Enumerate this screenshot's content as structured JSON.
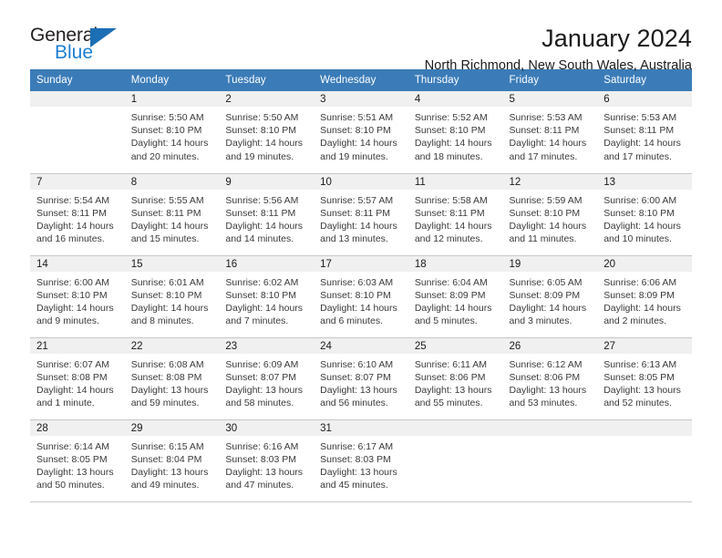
{
  "brand": {
    "name_part1": "General",
    "name_part2": "Blue",
    "accent_color": "#1b7fd4",
    "triangle_color": "#1c6fb5"
  },
  "header": {
    "title": "January 2024",
    "subtitle": "North Richmond, New South Wales, Australia",
    "header_bg_color": "#3b7cb8",
    "daynum_bg_color": "#f0f0f0"
  },
  "calendar": {
    "weekday_headers": [
      "Sunday",
      "Monday",
      "Tuesday",
      "Wednesday",
      "Thursday",
      "Friday",
      "Saturday"
    ],
    "weeks": [
      [
        {
          "day": "",
          "sunrise": "",
          "sunset": "",
          "daylight_line1": "",
          "daylight_line2": "",
          "empty": true
        },
        {
          "day": "1",
          "sunrise": "Sunrise: 5:50 AM",
          "sunset": "Sunset: 8:10 PM",
          "daylight_line1": "Daylight: 14 hours",
          "daylight_line2": "and 20 minutes."
        },
        {
          "day": "2",
          "sunrise": "Sunrise: 5:50 AM",
          "sunset": "Sunset: 8:10 PM",
          "daylight_line1": "Daylight: 14 hours",
          "daylight_line2": "and 19 minutes."
        },
        {
          "day": "3",
          "sunrise": "Sunrise: 5:51 AM",
          "sunset": "Sunset: 8:10 PM",
          "daylight_line1": "Daylight: 14 hours",
          "daylight_line2": "and 19 minutes."
        },
        {
          "day": "4",
          "sunrise": "Sunrise: 5:52 AM",
          "sunset": "Sunset: 8:10 PM",
          "daylight_line1": "Daylight: 14 hours",
          "daylight_line2": "and 18 minutes."
        },
        {
          "day": "5",
          "sunrise": "Sunrise: 5:53 AM",
          "sunset": "Sunset: 8:11 PM",
          "daylight_line1": "Daylight: 14 hours",
          "daylight_line2": "and 17 minutes."
        },
        {
          "day": "6",
          "sunrise": "Sunrise: 5:53 AM",
          "sunset": "Sunset: 8:11 PM",
          "daylight_line1": "Daylight: 14 hours",
          "daylight_line2": "and 17 minutes."
        }
      ],
      [
        {
          "day": "7",
          "sunrise": "Sunrise: 5:54 AM",
          "sunset": "Sunset: 8:11 PM",
          "daylight_line1": "Daylight: 14 hours",
          "daylight_line2": "and 16 minutes."
        },
        {
          "day": "8",
          "sunrise": "Sunrise: 5:55 AM",
          "sunset": "Sunset: 8:11 PM",
          "daylight_line1": "Daylight: 14 hours",
          "daylight_line2": "and 15 minutes."
        },
        {
          "day": "9",
          "sunrise": "Sunrise: 5:56 AM",
          "sunset": "Sunset: 8:11 PM",
          "daylight_line1": "Daylight: 14 hours",
          "daylight_line2": "and 14 minutes."
        },
        {
          "day": "10",
          "sunrise": "Sunrise: 5:57 AM",
          "sunset": "Sunset: 8:11 PM",
          "daylight_line1": "Daylight: 14 hours",
          "daylight_line2": "and 13 minutes."
        },
        {
          "day": "11",
          "sunrise": "Sunrise: 5:58 AM",
          "sunset": "Sunset: 8:11 PM",
          "daylight_line1": "Daylight: 14 hours",
          "daylight_line2": "and 12 minutes."
        },
        {
          "day": "12",
          "sunrise": "Sunrise: 5:59 AM",
          "sunset": "Sunset: 8:10 PM",
          "daylight_line1": "Daylight: 14 hours",
          "daylight_line2": "and 11 minutes."
        },
        {
          "day": "13",
          "sunrise": "Sunrise: 6:00 AM",
          "sunset": "Sunset: 8:10 PM",
          "daylight_line1": "Daylight: 14 hours",
          "daylight_line2": "and 10 minutes."
        }
      ],
      [
        {
          "day": "14",
          "sunrise": "Sunrise: 6:00 AM",
          "sunset": "Sunset: 8:10 PM",
          "daylight_line1": "Daylight: 14 hours",
          "daylight_line2": "and 9 minutes."
        },
        {
          "day": "15",
          "sunrise": "Sunrise: 6:01 AM",
          "sunset": "Sunset: 8:10 PM",
          "daylight_line1": "Daylight: 14 hours",
          "daylight_line2": "and 8 minutes."
        },
        {
          "day": "16",
          "sunrise": "Sunrise: 6:02 AM",
          "sunset": "Sunset: 8:10 PM",
          "daylight_line1": "Daylight: 14 hours",
          "daylight_line2": "and 7 minutes."
        },
        {
          "day": "17",
          "sunrise": "Sunrise: 6:03 AM",
          "sunset": "Sunset: 8:10 PM",
          "daylight_line1": "Daylight: 14 hours",
          "daylight_line2": "and 6 minutes."
        },
        {
          "day": "18",
          "sunrise": "Sunrise: 6:04 AM",
          "sunset": "Sunset: 8:09 PM",
          "daylight_line1": "Daylight: 14 hours",
          "daylight_line2": "and 5 minutes."
        },
        {
          "day": "19",
          "sunrise": "Sunrise: 6:05 AM",
          "sunset": "Sunset: 8:09 PM",
          "daylight_line1": "Daylight: 14 hours",
          "daylight_line2": "and 3 minutes."
        },
        {
          "day": "20",
          "sunrise": "Sunrise: 6:06 AM",
          "sunset": "Sunset: 8:09 PM",
          "daylight_line1": "Daylight: 14 hours",
          "daylight_line2": "and 2 minutes."
        }
      ],
      [
        {
          "day": "21",
          "sunrise": "Sunrise: 6:07 AM",
          "sunset": "Sunset: 8:08 PM",
          "daylight_line1": "Daylight: 14 hours",
          "daylight_line2": "and 1 minute."
        },
        {
          "day": "22",
          "sunrise": "Sunrise: 6:08 AM",
          "sunset": "Sunset: 8:08 PM",
          "daylight_line1": "Daylight: 13 hours",
          "daylight_line2": "and 59 minutes."
        },
        {
          "day": "23",
          "sunrise": "Sunrise: 6:09 AM",
          "sunset": "Sunset: 8:07 PM",
          "daylight_line1": "Daylight: 13 hours",
          "daylight_line2": "and 58 minutes."
        },
        {
          "day": "24",
          "sunrise": "Sunrise: 6:10 AM",
          "sunset": "Sunset: 8:07 PM",
          "daylight_line1": "Daylight: 13 hours",
          "daylight_line2": "and 56 minutes."
        },
        {
          "day": "25",
          "sunrise": "Sunrise: 6:11 AM",
          "sunset": "Sunset: 8:06 PM",
          "daylight_line1": "Daylight: 13 hours",
          "daylight_line2": "and 55 minutes."
        },
        {
          "day": "26",
          "sunrise": "Sunrise: 6:12 AM",
          "sunset": "Sunset: 8:06 PM",
          "daylight_line1": "Daylight: 13 hours",
          "daylight_line2": "and 53 minutes."
        },
        {
          "day": "27",
          "sunrise": "Sunrise: 6:13 AM",
          "sunset": "Sunset: 8:05 PM",
          "daylight_line1": "Daylight: 13 hours",
          "daylight_line2": "and 52 minutes."
        }
      ],
      [
        {
          "day": "28",
          "sunrise": "Sunrise: 6:14 AM",
          "sunset": "Sunset: 8:05 PM",
          "daylight_line1": "Daylight: 13 hours",
          "daylight_line2": "and 50 minutes."
        },
        {
          "day": "29",
          "sunrise": "Sunrise: 6:15 AM",
          "sunset": "Sunset: 8:04 PM",
          "daylight_line1": "Daylight: 13 hours",
          "daylight_line2": "and 49 minutes."
        },
        {
          "day": "30",
          "sunrise": "Sunrise: 6:16 AM",
          "sunset": "Sunset: 8:03 PM",
          "daylight_line1": "Daylight: 13 hours",
          "daylight_line2": "and 47 minutes."
        },
        {
          "day": "31",
          "sunrise": "Sunrise: 6:17 AM",
          "sunset": "Sunset: 8:03 PM",
          "daylight_line1": "Daylight: 13 hours",
          "daylight_line2": "and 45 minutes."
        },
        {
          "day": "",
          "sunrise": "",
          "sunset": "",
          "daylight_line1": "",
          "daylight_line2": "",
          "empty": true
        },
        {
          "day": "",
          "sunrise": "",
          "sunset": "",
          "daylight_line1": "",
          "daylight_line2": "",
          "empty": true
        },
        {
          "day": "",
          "sunrise": "",
          "sunset": "",
          "daylight_line1": "",
          "daylight_line2": "",
          "empty": true
        }
      ]
    ]
  }
}
